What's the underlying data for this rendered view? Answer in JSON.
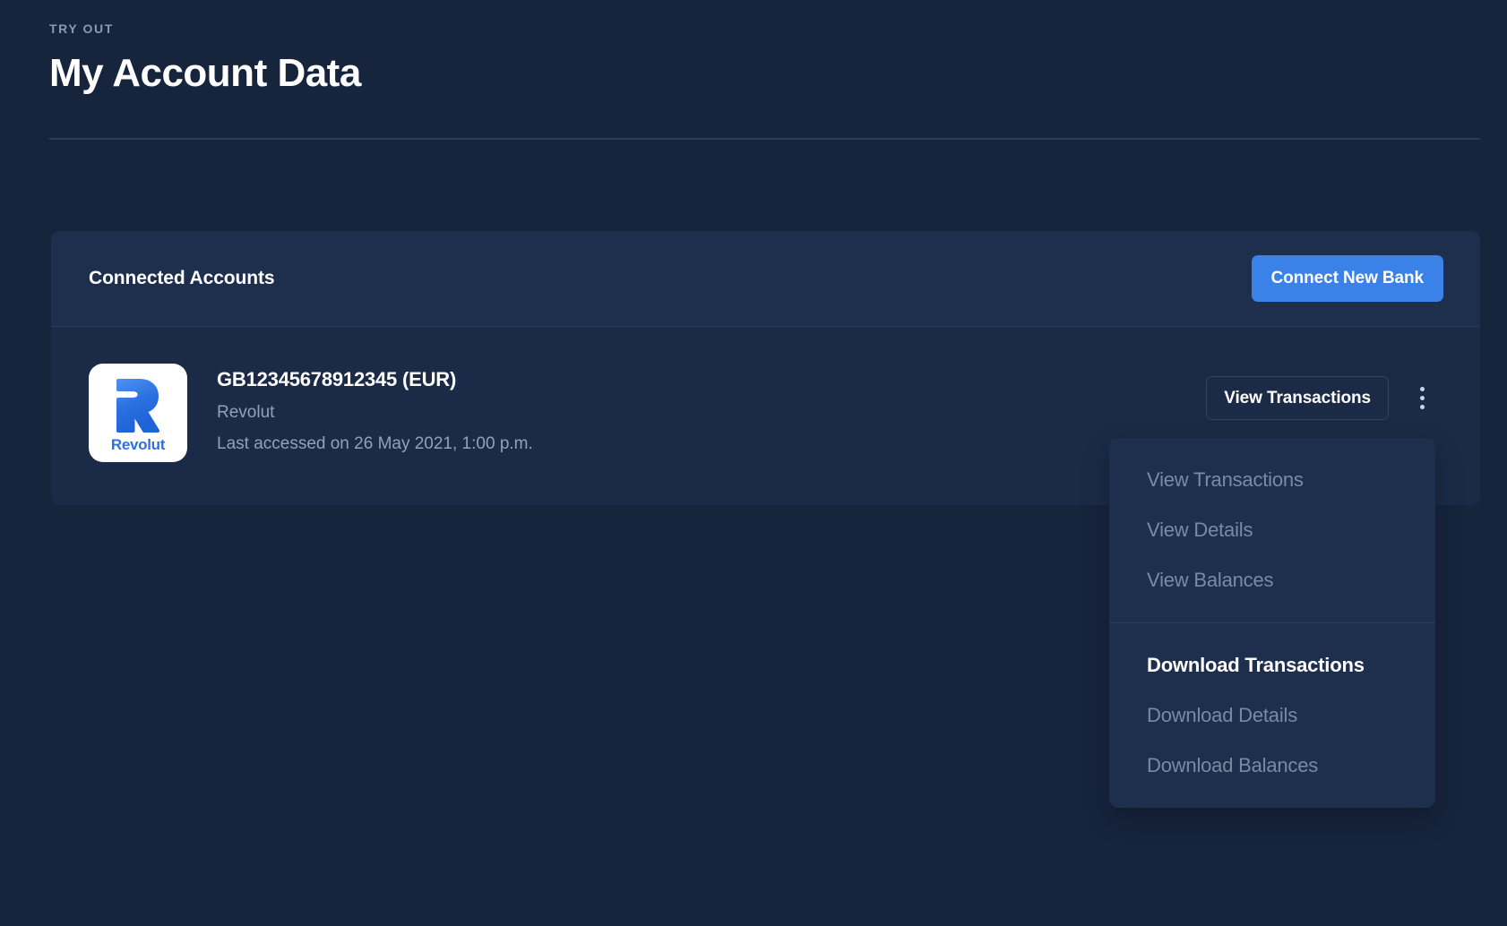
{
  "header": {
    "eyebrow": "TRY OUT",
    "title": "My Account Data"
  },
  "card": {
    "title": "Connected Accounts",
    "connect_button": "Connect New Bank"
  },
  "account": {
    "logo_text": "Revolut",
    "logo_letter": "R",
    "iban": "GB12345678912345 (EUR)",
    "provider": "Revolut",
    "last_accessed": "Last accessed on 26 May 2021, 1:00 p.m.",
    "view_transactions_button": "View Transactions",
    "kebab_icon": "more-vertical-icon"
  },
  "dropdown": {
    "group_view": [
      {
        "label": "View Transactions",
        "enabled": false
      },
      {
        "label": "View Details",
        "enabled": false
      },
      {
        "label": "View Balances",
        "enabled": false
      }
    ],
    "group_download": [
      {
        "label": "Download Transactions",
        "enabled": true
      },
      {
        "label": "Download Details",
        "enabled": false
      },
      {
        "label": "Download Balances",
        "enabled": false
      }
    ]
  },
  "colors": {
    "page_background": "#16243c",
    "card_background": "#1b2b47",
    "card_header_background": "#1e2f4d",
    "accent_blue": "#3b82e8",
    "muted_text": "#93a1b8",
    "disabled_text": "#7a8aa4",
    "divider": "#2c3c58",
    "revolut_blue": "#2f6fe4"
  }
}
